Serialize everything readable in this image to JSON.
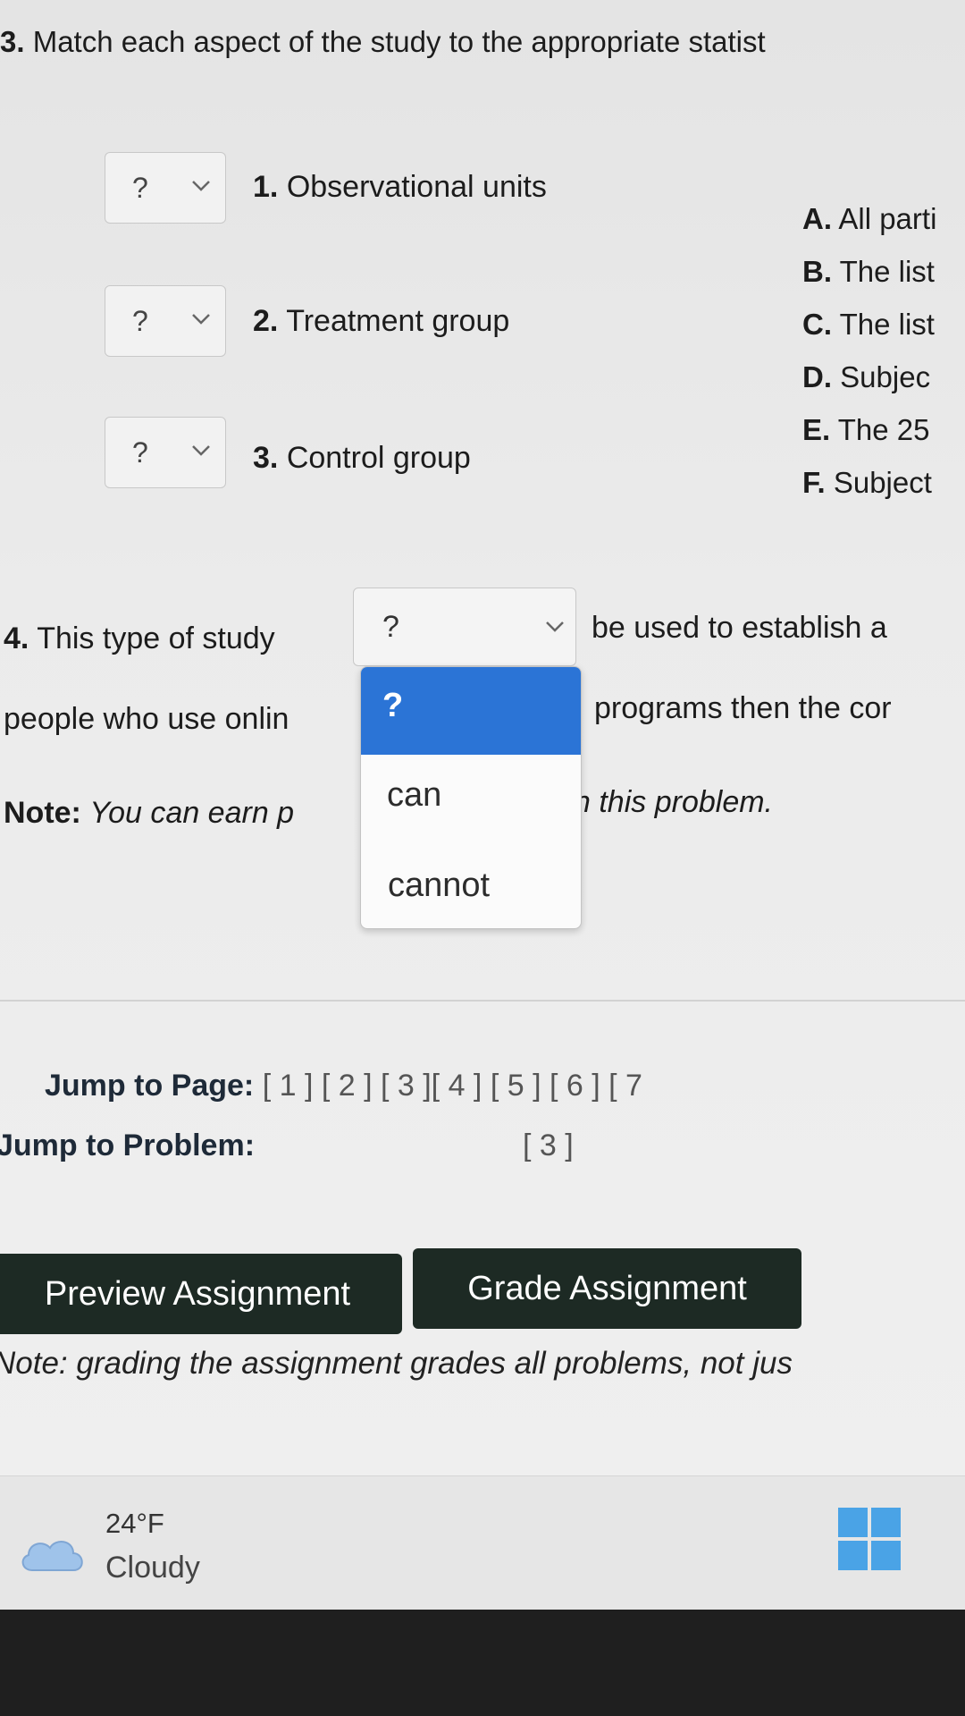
{
  "q3": {
    "number": "3.",
    "text": "Match each aspect of the study to the appropriate statist",
    "items": [
      {
        "select_value": "?",
        "number": "1.",
        "label": "Observational units"
      },
      {
        "select_value": "?",
        "number": "2.",
        "label": "Treatment group"
      },
      {
        "select_value": "?",
        "number": "3.",
        "label": "Control group"
      }
    ],
    "answers": [
      {
        "letter": "A.",
        "text": "All parti"
      },
      {
        "letter": "B.",
        "text": "The list"
      },
      {
        "letter": "C.",
        "text": "The list"
      },
      {
        "letter": "D.",
        "text": "Subjec"
      },
      {
        "letter": "E.",
        "text": "The 25"
      },
      {
        "letter": "F.",
        "text": "Subject"
      }
    ]
  },
  "q4": {
    "number": "4.",
    "text_before": "This type of study",
    "select_value": "?",
    "text_after": "be used to establish a",
    "line2_left": "people who use onlin",
    "line2_right": "programs then the cor",
    "dropdown_options": [
      "?",
      "can",
      "cannot"
    ],
    "note_label": "Note:",
    "note_text": "You can earn p",
    "note_text_right": "n this problem."
  },
  "jump": {
    "page_label": "Jump to Page:",
    "pages": "[ 1 ] [ 2 ] [ 3 ][ 4 ] [ 5 ] [ 6 ] [ 7",
    "problem_label": "Jump to Problem:",
    "problem_link": "[ 3 ]"
  },
  "buttons": {
    "preview": "Preview Assignment",
    "grade": "Grade Assignment"
  },
  "grade_note": "Note: grading the assignment grades all problems, not jus",
  "taskbar": {
    "temperature": "24°F",
    "condition": "Cloudy",
    "weather_icon": "cloud-icon",
    "start_icon": "windows-logo-icon"
  },
  "colors": {
    "dropdown_highlight": "#2b74d6",
    "button_bg": "#1d2a24"
  }
}
